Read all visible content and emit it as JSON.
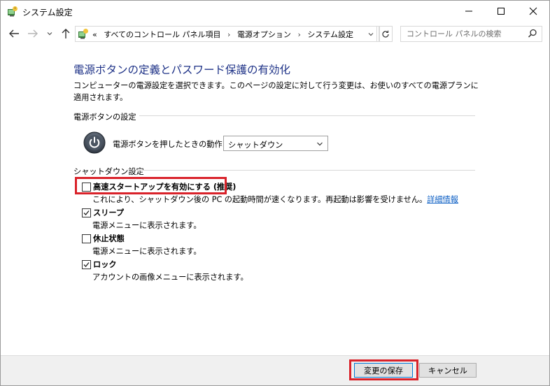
{
  "window": {
    "title": "システム設定",
    "icon": "control-panel-power-icon"
  },
  "navbar": {
    "recent_glyph": "⌄",
    "address": {
      "prefix": "«",
      "crumbs": [
        "すべてのコントロール パネル項目",
        "電源オプション",
        "システム設定"
      ],
      "separator": "›"
    },
    "search_placeholder": "コントロール パネルの検索"
  },
  "content": {
    "title": "電源ボタンの定義とパスワード保護の有効化",
    "description": "コンピューターの電源設定を選択できます。このページの設定に対して行う変更は、お使いのすべての電源プランに適用されます。",
    "power_section": {
      "heading": "電源ボタンの設定",
      "row_label": "電源ボタンを押したときの動作:",
      "selected": "シャットダウン"
    },
    "shutdown_section": {
      "heading": "シャットダウン設定",
      "options": [
        {
          "label": "高速スタートアップを有効にする (推奨)",
          "desc": "これにより、シャットダウン後の PC の起動時間が速くなります。再起動は影響を受けません。",
          "link": "詳細情報",
          "checked": false
        },
        {
          "label": "スリープ",
          "desc": "電源メニューに表示されます。",
          "checked": true
        },
        {
          "label": "休止状態",
          "desc": "電源メニューに表示されます。",
          "checked": false
        },
        {
          "label": "ロック",
          "desc": "アカウントの画像メニューに表示されます。",
          "checked": true
        }
      ]
    }
  },
  "footer": {
    "save_label": "変更の保存",
    "cancel_label": "キャンセル"
  },
  "colors": {
    "title_blue": "#1e3287",
    "link_blue": "#0b5ec4",
    "highlight_red": "#d9222a"
  }
}
